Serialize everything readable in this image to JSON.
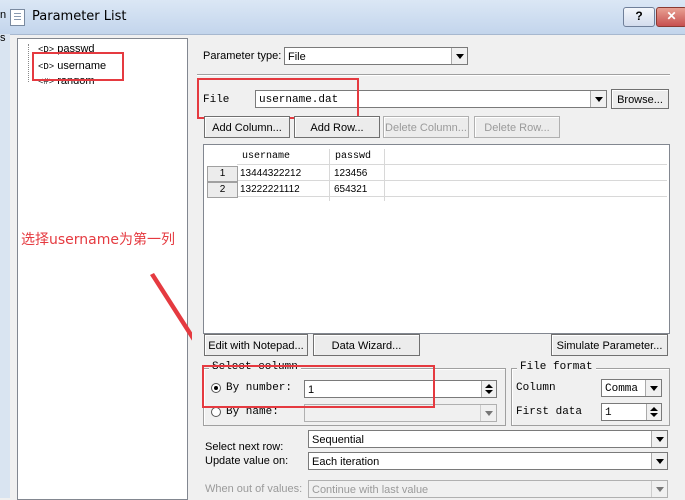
{
  "window": {
    "title": "Parameter List",
    "help_label": "?",
    "close_label": "✕",
    "left_frag_1": "n",
    "left_frag_2": "s"
  },
  "tree": {
    "items": [
      {
        "icon": "<D>",
        "label": "passwd"
      },
      {
        "icon": "<D>",
        "label": "username"
      },
      {
        "icon": "<#>",
        "label": "random"
      }
    ]
  },
  "annotation": {
    "text": "选择username为第一列",
    "color": "#e53a40"
  },
  "param_type": {
    "label": "Parameter type:",
    "value": "File"
  },
  "file": {
    "label": "File",
    "value": "username.dat",
    "browse_label": "Browse..."
  },
  "toolbar": {
    "add_column": "Add Column...",
    "add_row": "Add Row...",
    "delete_column": "Delete Column...",
    "delete_row": "Delete Row..."
  },
  "table": {
    "columns": [
      "username",
      "passwd"
    ],
    "rows": [
      {
        "num": "1",
        "cells": [
          "13444322212",
          "123456"
        ]
      },
      {
        "num": "2",
        "cells": [
          "13222221112",
          "654321"
        ]
      }
    ]
  },
  "actions": {
    "edit_notepad": "Edit with Notepad...",
    "data_wizard": "Data Wizard...",
    "simulate": "Simulate Parameter..."
  },
  "select_column": {
    "legend": "Select column",
    "by_number_label": "By number:",
    "by_number_value": "1",
    "by_name_label": "By name:"
  },
  "file_format": {
    "legend": "File format",
    "column_label": "Column",
    "column_value": "Comma",
    "first_data_label": "First data",
    "first_data_value": "1"
  },
  "next_row": {
    "label": "Select next row:",
    "value": "Sequential"
  },
  "update_value": {
    "label": "Update value on:",
    "value": "Each iteration"
  },
  "out_of_values": {
    "label": "When out of values:",
    "value": "Continue with last value"
  }
}
